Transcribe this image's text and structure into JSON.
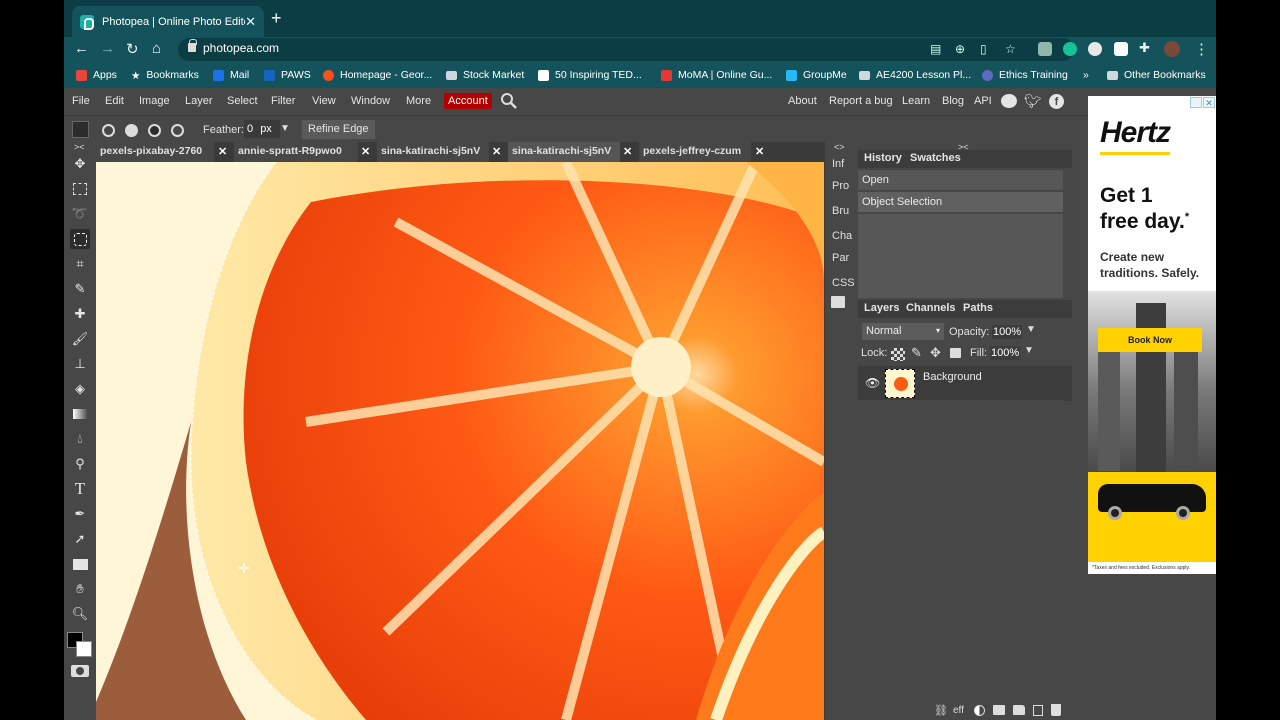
{
  "browser": {
    "tab_title": "Photopea | Online Photo Editor",
    "tab_close": "✕",
    "new_tab": "+",
    "url": "photopea.com",
    "bookmarks": [
      {
        "label": "Apps",
        "color": "#e9453a"
      },
      {
        "label": "Bookmarks",
        "color": "#ffffff"
      },
      {
        "label": "Mail",
        "color": "#1a73e8"
      },
      {
        "label": "PAWS",
        "color": "#1565c0"
      },
      {
        "label": "Homepage - Geor...",
        "color": "#f4511e"
      },
      {
        "label": "Stock Market",
        "color": "#cfd8dc"
      },
      {
        "label": "50 Inspiring TED...",
        "color": "#ffffff"
      },
      {
        "label": "MoMA | Online Gu...",
        "color": "#e53935"
      },
      {
        "label": "GroupMe",
        "color": "#29b6f6"
      },
      {
        "label": "AE4200 Lesson Pl...",
        "color": "#cfd8dc"
      },
      {
        "label": "Ethics Training",
        "color": "#5c6bc0"
      },
      {
        "label": "»",
        "color": ""
      },
      {
        "label": "Other Bookmarks",
        "color": "#cfd8dc"
      }
    ]
  },
  "photopea": {
    "menus": [
      "File",
      "Edit",
      "Image",
      "Layer",
      "Select",
      "Filter",
      "View",
      "Window",
      "More"
    ],
    "account": "Account",
    "right_links": [
      "About",
      "Report a bug",
      "Learn",
      "Blog",
      "API"
    ],
    "options": {
      "feather_label": "Feather:",
      "feather_value": "0",
      "feather_unit": "px",
      "refine_edge": "Refine Edge"
    },
    "doc_tabs": [
      "pexels-pixabay-2760",
      "annie-spratt-R9pwo0",
      "sina-katirachi-sj5nV",
      "sina-katirachi-sj5nV",
      "pexels-jeffrey-czum"
    ],
    "doc_tab_close": "✕",
    "mini_panels": [
      "Inf",
      "Pro",
      "Bru",
      "Cha",
      "Par",
      "CSS"
    ],
    "history": {
      "tabs": [
        "History",
        "Swatches"
      ],
      "items": [
        "Open",
        "Object Selection"
      ]
    },
    "layers": {
      "tabs": [
        "Layers",
        "Channels",
        "Paths"
      ],
      "blend_mode": "Normal",
      "opacity_label": "Opacity:",
      "opacity": "100%",
      "lock_label": "Lock:",
      "fill_label": "Fill:",
      "fill": "100%",
      "layer_name": "Background",
      "footer_fx": "eff"
    }
  },
  "ad": {
    "brand": "Hertz",
    "headline_1": "Get 1",
    "headline_2": "free day.",
    "star": "*",
    "sub_1": "Create new",
    "sub_2": "traditions. Safely.",
    "cta": "Book Now",
    "fine_print": "*Taxes and fees excluded. Exclusions apply."
  },
  "colors": {
    "chrome_dark": "#0c3c44",
    "chrome": "#15535c",
    "panel": "#474747",
    "account_red": "#b10000",
    "hertz_yellow": "#ffd100"
  }
}
